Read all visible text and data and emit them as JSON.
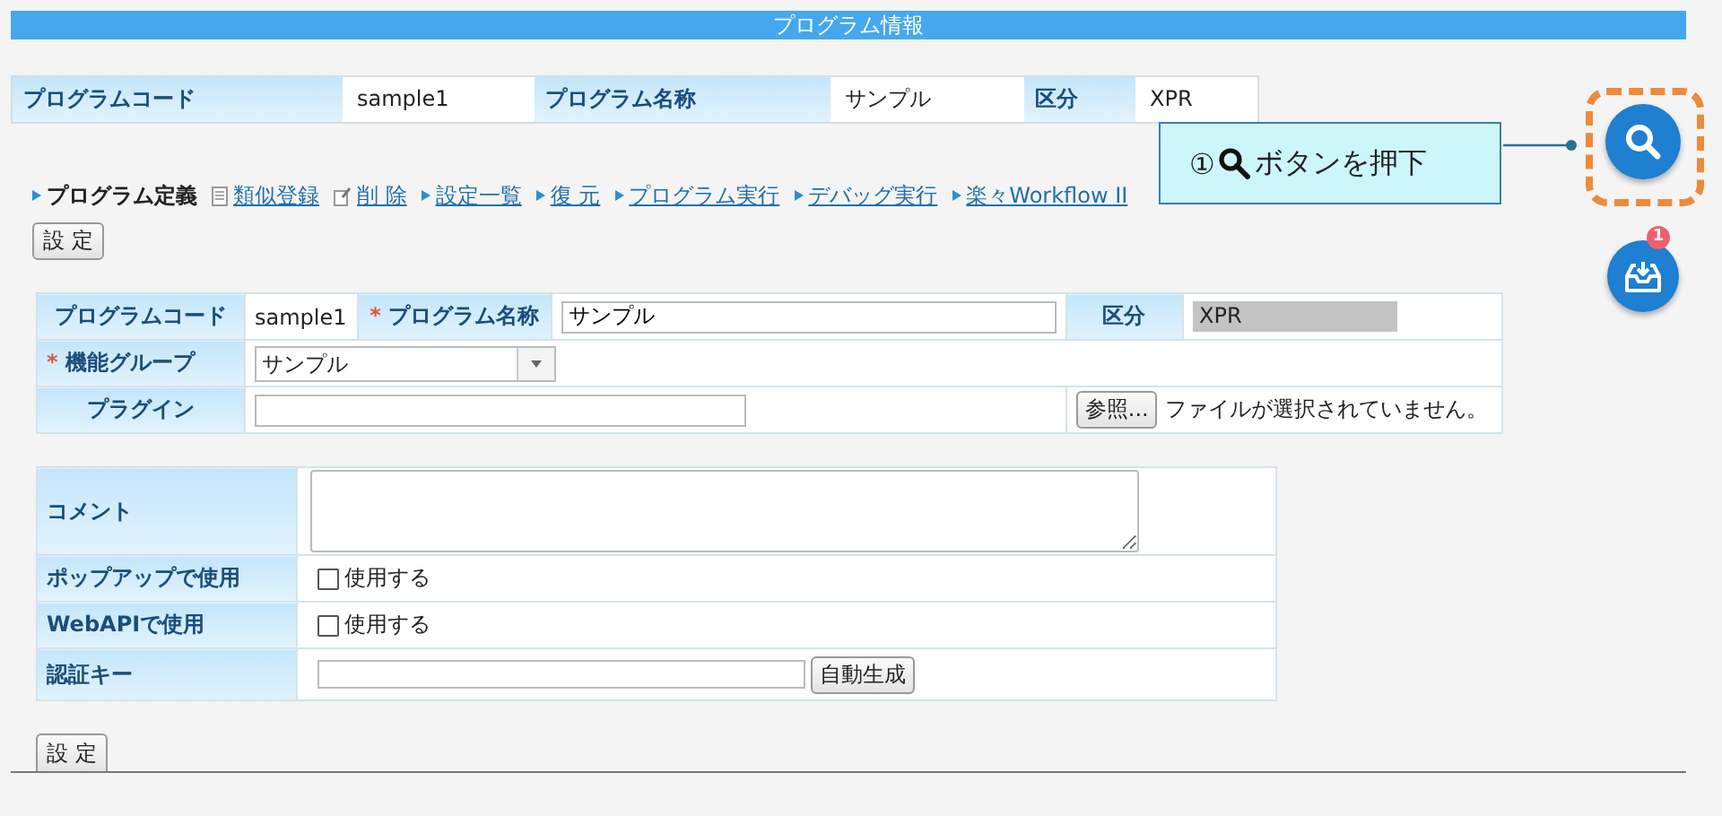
{
  "title": "プログラム情報",
  "summary": [
    {
      "label": "プログラムコード",
      "value": "sample1"
    },
    {
      "label": "プログラム名称",
      "value": "サンプル"
    },
    {
      "label": "区分",
      "value": "XPR"
    }
  ],
  "links": [
    {
      "label": "プログラム定義",
      "kind": "current"
    },
    {
      "label": "類似登録",
      "kind": "doc"
    },
    {
      "label": "削 除",
      "kind": "edit"
    },
    {
      "label": "設定一覧",
      "kind": "link"
    },
    {
      "label": "復 元",
      "kind": "link"
    },
    {
      "label": "プログラム実行",
      "kind": "link"
    },
    {
      "label": "デバッグ実行",
      "kind": "link"
    },
    {
      "label": "楽々Workflow II",
      "kind": "link"
    }
  ],
  "top_button": "設 定",
  "form": {
    "code_label": "プログラムコード",
    "code_value": "sample1",
    "name_label": "プログラム名称",
    "name_mark": "*",
    "name_value": "サンプル",
    "type_label": "区分",
    "type_value": "XPR",
    "group_label": "機能グループ",
    "group_mark": "*",
    "group_value": "サンプル",
    "plugin_label": "プラグイン",
    "browse_button": "参照...",
    "no_file": "ファイルが選択されていません。"
  },
  "options": [
    {
      "kind": "textarea",
      "label": "コメント"
    },
    {
      "kind": "checkbox",
      "label": "ポップアップで使用",
      "text": "使用する",
      "checked": false
    },
    {
      "kind": "checkbox",
      "label": "WebAPIで使用",
      "text": "使用する",
      "checked": false
    },
    {
      "kind": "key",
      "label": "認証キー",
      "button": "自動生成"
    }
  ],
  "bottom_button": "設 定",
  "callout": {
    "number": "①",
    "text": "ボタンを押下"
  },
  "inbox_badge": "1"
}
